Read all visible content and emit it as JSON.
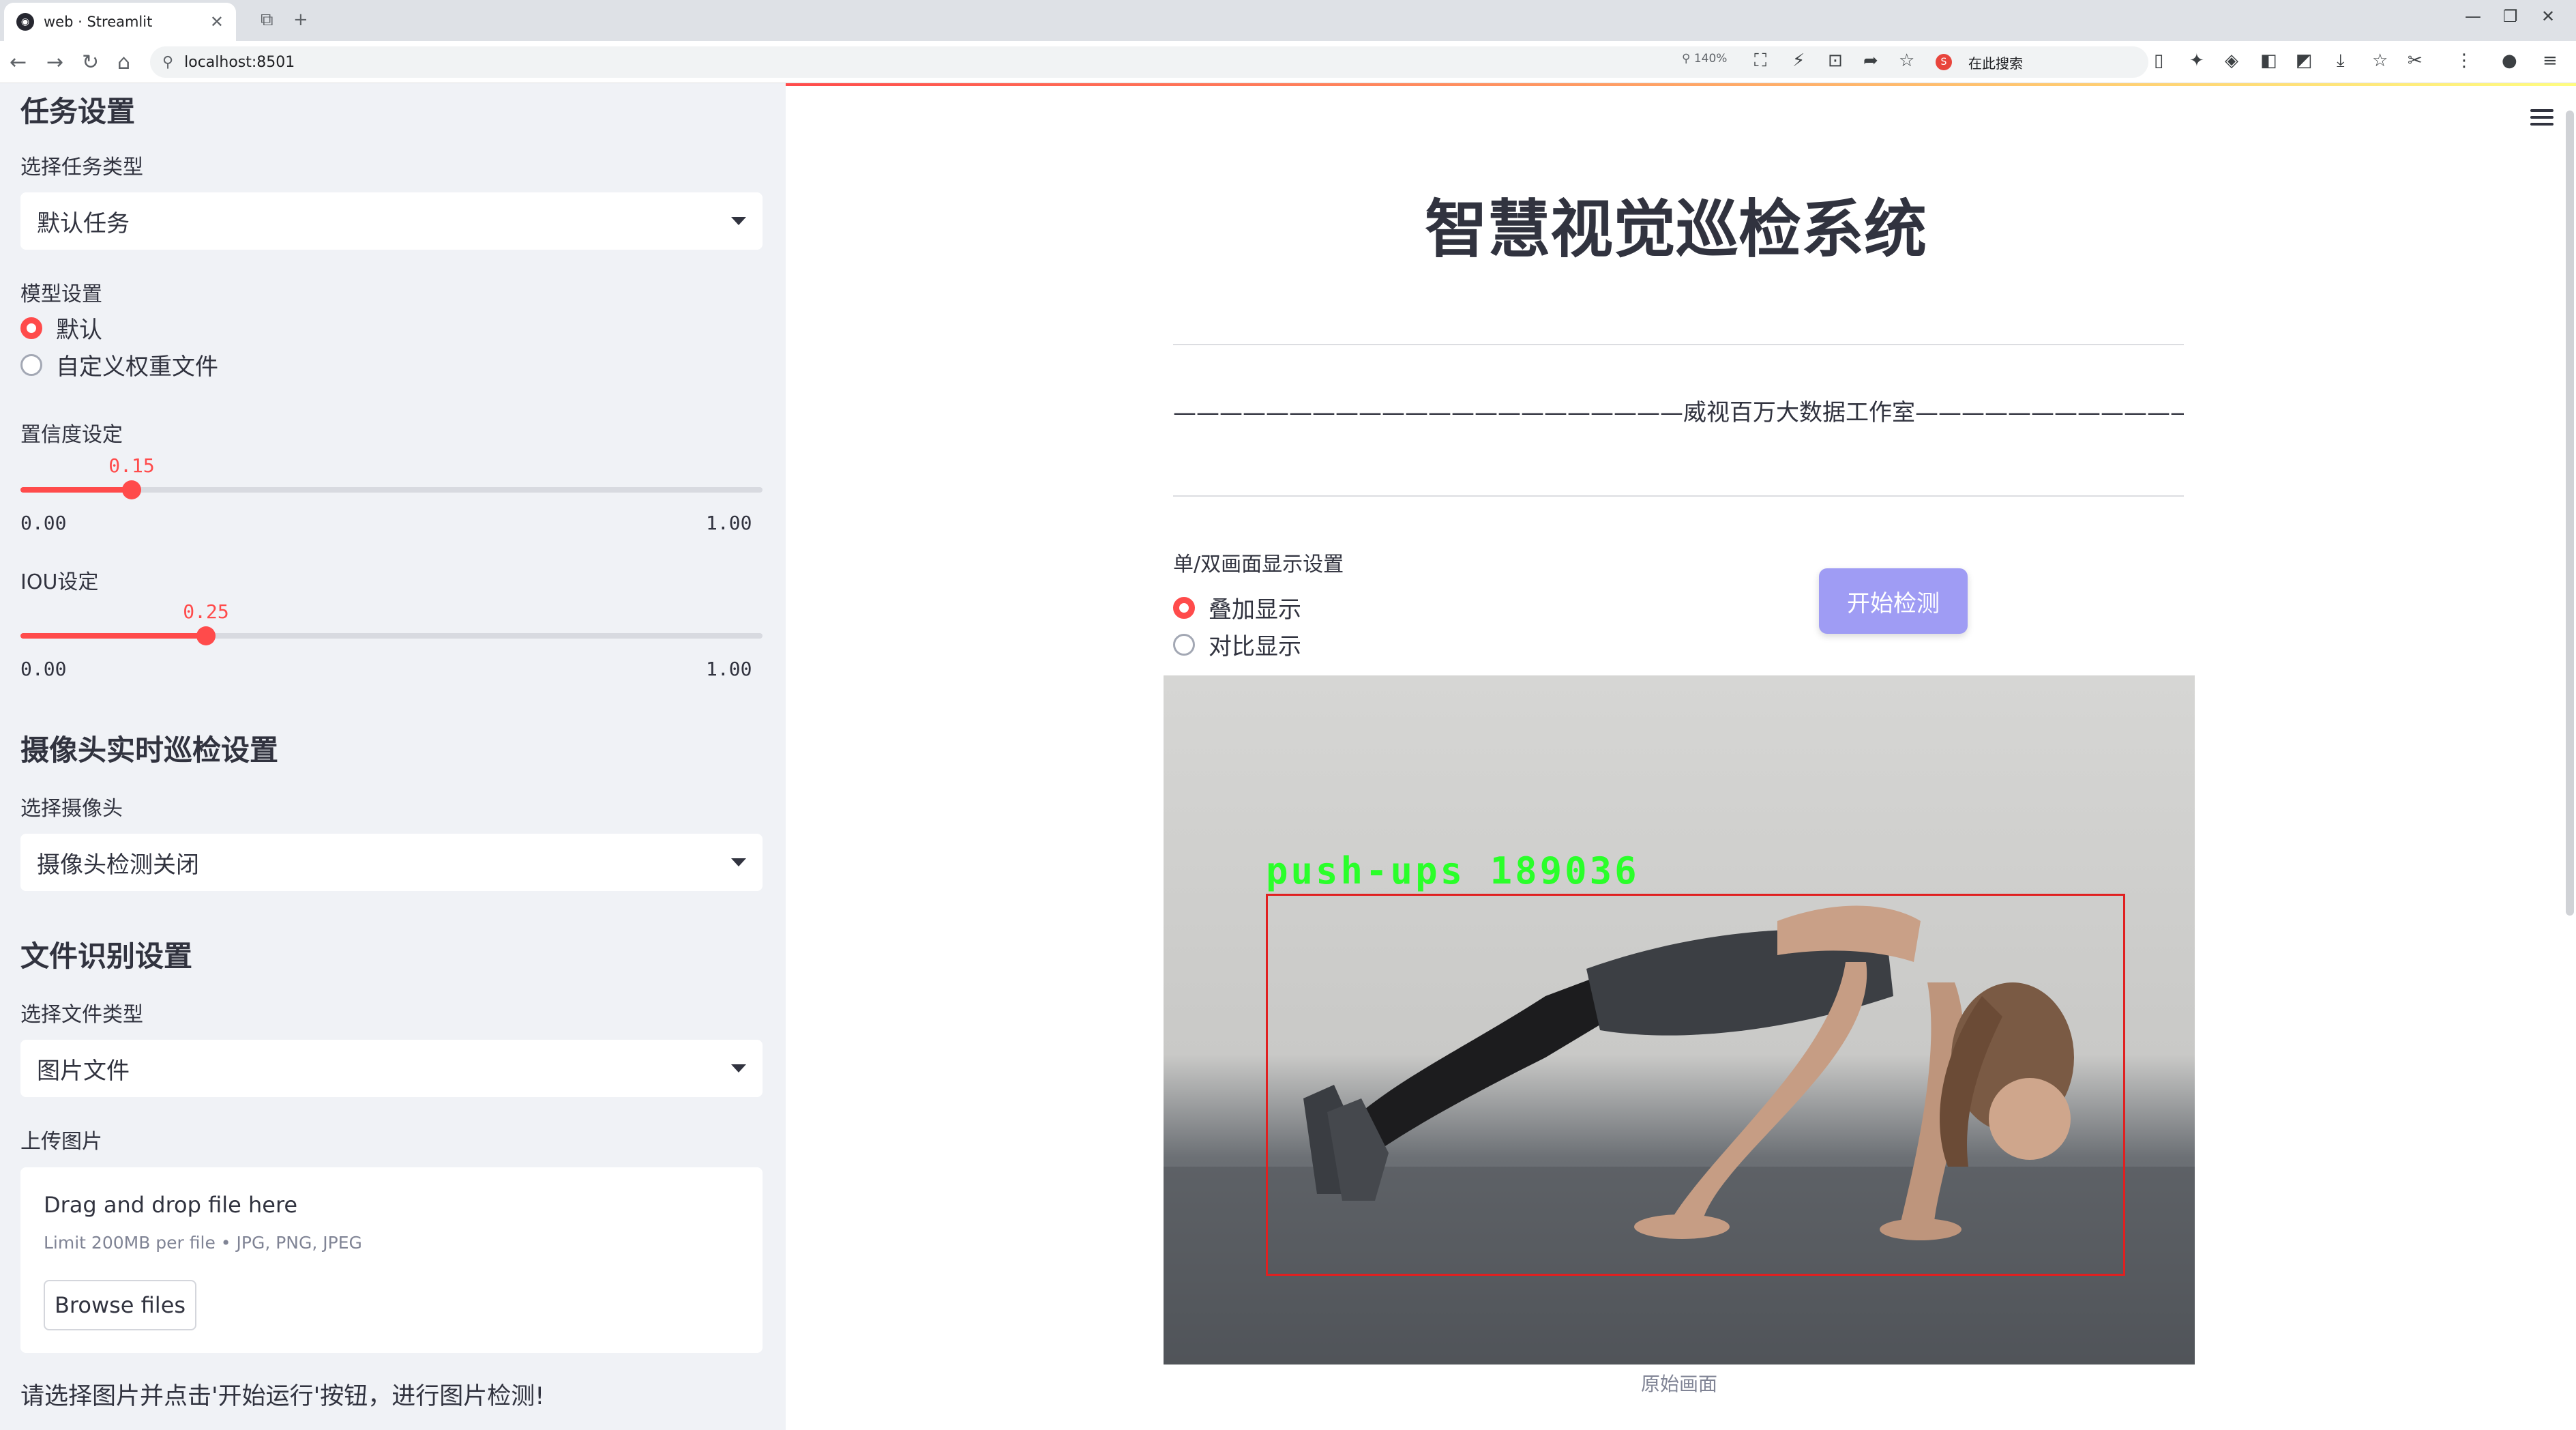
{
  "browser": {
    "tab_title": "web · Streamlit",
    "url": "localhost:8501",
    "zoom": "140%",
    "search_placeholder": "在此搜索"
  },
  "sidebar": {
    "task_section": {
      "heading": "任务设置",
      "select_label": "选择任务类型",
      "select_value": "默认任务"
    },
    "model_section": {
      "label": "模型设置",
      "options": [
        "默认",
        "自定义权重文件"
      ],
      "selected": 0
    },
    "confidence": {
      "label": "置信度设定",
      "value": "0.15",
      "value_num": 0.15,
      "min": "0.00",
      "max": "1.00"
    },
    "iou": {
      "label": "IOU设定",
      "value": "0.25",
      "value_num": 0.25,
      "min": "0.00",
      "max": "1.00"
    },
    "camera_section": {
      "heading": "摄像头实时巡检设置",
      "select_label": "选择摄像头",
      "select_value": "摄像头检测关闭"
    },
    "file_section": {
      "heading": "文件识别设置",
      "select_label": "选择文件类型",
      "select_value": "图片文件",
      "upload_label": "上传图片",
      "drop_text": "Drag and drop file here",
      "limit_text": "Limit 200MB per file • JPG, PNG, JPEG",
      "browse_label": "Browse files"
    },
    "note": "请选择图片并点击'开始运行'按钮，进行图片检测!"
  },
  "main": {
    "title": "智慧视觉巡检系统",
    "studio_line": "——————————————————————威视百万大数据工作室———————————————————————",
    "display_mode": {
      "label": "单/双画面显示设置",
      "options": [
        "叠加显示",
        "对比显示"
      ],
      "selected": 0
    },
    "start_button": "开始检测",
    "detection": {
      "label": "push-ups  189036"
    },
    "caption": "原始画面"
  },
  "colors": {
    "accent": "#ff4b4b",
    "button": "#9f9cf4",
    "sidebar_bg": "#f0f2f6",
    "detection_box": "#e02020",
    "detection_text": "#2aff2a"
  }
}
